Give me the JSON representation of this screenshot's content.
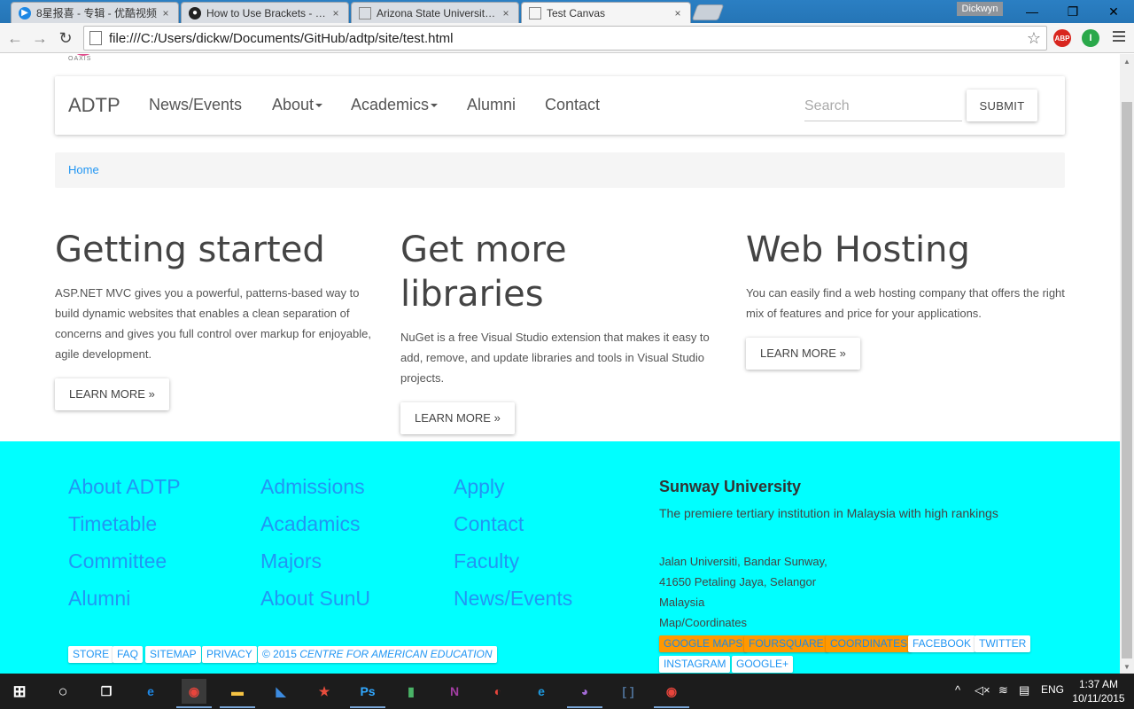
{
  "browser": {
    "tabs": [
      {
        "title": "8星报喜 - 专辑 - 优酷视频",
        "icon": "youku-icon"
      },
      {
        "title": "How to Use Brackets - ado",
        "icon": "github-icon"
      },
      {
        "title": "Arizona State University | a",
        "icon": "page-icon"
      },
      {
        "title": "Test Canvas",
        "icon": "page-icon"
      }
    ],
    "close_glyph": "×",
    "profile_name": "Dickwyn",
    "url": "file:///C:/Users/dickw/Documents/GitHub/adtp/site/test.html",
    "extensions": [
      {
        "label": "ABP",
        "color": "#d8261f"
      },
      {
        "label": "I",
        "color": "#2aa84a"
      }
    ]
  },
  "page": {
    "navbar": {
      "brand": "ADTP",
      "links": [
        "News/Events",
        "About",
        "Academics",
        "Alumni",
        "Contact"
      ],
      "search_placeholder": "Search",
      "submit": "SUBMIT"
    },
    "logo_text": "OAXIS",
    "breadcrumb": "Home",
    "columns": [
      {
        "title": "Getting started",
        "body": "ASP.NET MVC gives you a powerful, patterns-based way to build dynamic websites that enables a clean separation of concerns and gives you full control over markup for enjoyable, agile development.",
        "button": "LEARN MORE »"
      },
      {
        "title": "Get more libraries",
        "body": "NuGet is a free Visual Studio extension that makes it easy to add, remove, and update libraries and tools in Visual Studio projects.",
        "button": "LEARN MORE »"
      },
      {
        "title": "Web Hosting",
        "body": "You can easily find a web hosting company that offers the right mix of features and price for your applications.",
        "button": "LEARN MORE »"
      }
    ],
    "footer": {
      "col1": [
        "About ADTP",
        "Timetable",
        "Committee",
        "Alumni"
      ],
      "col2": [
        "Admissions",
        "Acadamics",
        "Majors",
        "About SunU"
      ],
      "col3": [
        "Apply",
        "Contact",
        "Faculty",
        "News/Events"
      ],
      "university": {
        "name": "Sunway University",
        "tagline": "The premiere tertiary institution in Malaysia with high rankings",
        "address": [
          "Jalan Universiti, Bandar Sunway,",
          "41650 Petaling Jaya, Selangor",
          "Malaysia",
          "Map/Coordinates"
        ]
      },
      "social": [
        {
          "label": "GOOGLE MAPS",
          "style": "orange"
        },
        {
          "label": "FOURSQUARE",
          "style": "orange"
        },
        {
          "label": "COORDINATES",
          "style": "orange"
        },
        {
          "label": "FACEBOOK",
          "style": "white"
        },
        {
          "label": "TWITTER",
          "style": "white"
        },
        {
          "label": "INSTAGRAM",
          "style": "white"
        },
        {
          "label": "GOOGLE+",
          "style": "white"
        }
      ],
      "small_links": [
        "STORE",
        "FAQ",
        "SITEMAP",
        "PRIVACY"
      ],
      "copyright_prefix": "© 2015 ",
      "copyright_org": "CENTRE FOR AMERICAN EDUCATION"
    }
  },
  "taskbar": {
    "apps": [
      {
        "name": "edge-icon",
        "glyph": "e",
        "color": "#1e88e5"
      },
      {
        "name": "chrome-icon",
        "glyph": "◉",
        "color": "#e8453c",
        "active": true
      },
      {
        "name": "file-explorer-icon",
        "glyph": "▬",
        "color": "#f6c343"
      },
      {
        "name": "visual-studio-icon",
        "glyph": "◣",
        "color": "#3c8be0"
      },
      {
        "name": "wunderlist-icon",
        "glyph": "★",
        "color": "#e84d3d"
      },
      {
        "name": "photoshop-icon",
        "glyph": "Ps",
        "color": "#31a8ff"
      },
      {
        "name": "pushbullet-icon",
        "glyph": "▮",
        "color": "#4ab367"
      },
      {
        "name": "onenote-icon",
        "glyph": "N",
        "color": "#a33ea3"
      },
      {
        "name": "chrome-app-icon",
        "glyph": "◐",
        "color": "#e8453c"
      },
      {
        "name": "internet-explorer-icon",
        "glyph": "e",
        "color": "#1e9be0"
      },
      {
        "name": "github-desktop-icon",
        "glyph": "◕",
        "color": "#a36ad6"
      },
      {
        "name": "brackets-icon",
        "glyph": "[ ]",
        "color": "#4d6f95"
      },
      {
        "name": "chrome-2-icon",
        "glyph": "◉",
        "color": "#e8453c"
      }
    ],
    "language": "ENG",
    "time": "1:37 AM",
    "date": "10/11/2015"
  }
}
